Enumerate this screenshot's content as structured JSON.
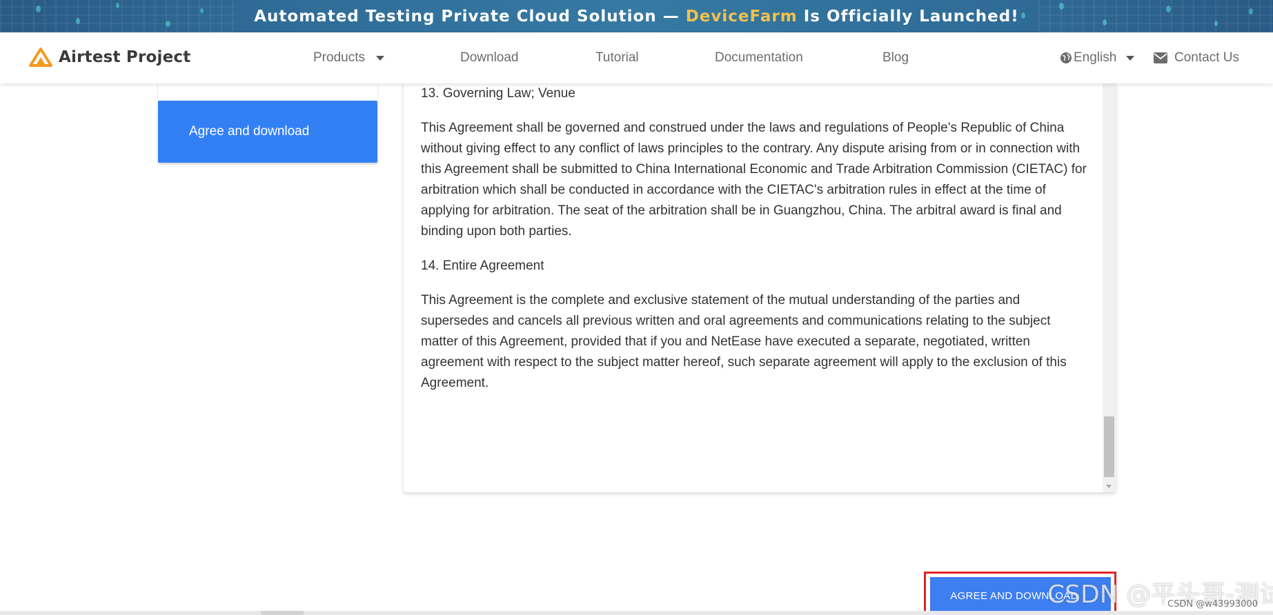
{
  "banner": {
    "text_before": "Automated Testing Private Cloud Solution — ",
    "highlight": "DeviceFarm",
    "text_after": " Is Officially Launched!",
    "highlight_color": "#f2c14e"
  },
  "navbar": {
    "logo_text": "Airtest Project",
    "items": [
      {
        "label": "Products"
      },
      {
        "label": "Download"
      },
      {
        "label": "Tutorial"
      },
      {
        "label": "Documentation"
      },
      {
        "label": "Blog"
      }
    ],
    "language": "English",
    "contact": "Contact Us"
  },
  "sidebar": {
    "agree_button": "Agree and download"
  },
  "agreement": {
    "section13_title": "13. Governing Law; Venue",
    "section13_body": "This Agreement shall be governed and construed under the laws and regulations of People’s Republic of China without giving effect to any conflict of laws principles to the contrary. Any dispute arising from or in connection with this Agreement shall be submitted to China International Economic and Trade Arbitration Commission (CIETAC) for arbitration which shall be conducted in accordance with the CIETAC's arbitration rules in effect at the time of applying for arbitration. The seat of the arbitration shall be in Guangzhou, China. The arbitral award is final and binding upon both parties.",
    "section14_title": "14. Entire Agreement",
    "section14_body": "This Agreement is the complete and exclusive statement of the mutual understanding of the parties and supersedes and cancels all previous written and oral agreements and communications relating to the subject matter of this Agreement, provided that if you and NetEase have executed a separate, negotiated, written agreement with respect to the subject matter hereof, such separate agreement will apply to the exclusion of this Agreement."
  },
  "bottom": {
    "agree_button": "AGREE AND DOWNLOAD"
  },
  "watermark": {
    "main": "CSDN @平头哥-测试",
    "sub": "CSDN @w43993000"
  },
  "colors": {
    "primary_button": "#3380f5",
    "highlight_border": "#e02424",
    "logo_orange": "#f39a1e"
  }
}
